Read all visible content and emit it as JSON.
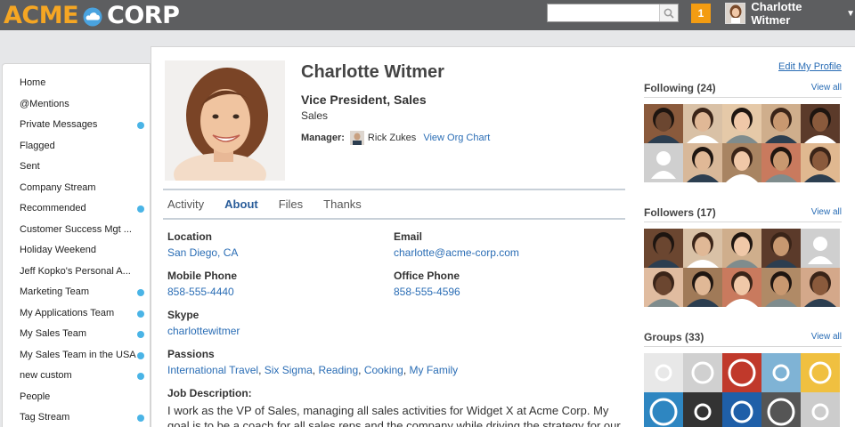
{
  "brand": {
    "acme": "ACME",
    "corp": "CORP",
    "logo_icon": "cloud-icon",
    "accent": "#f5a623"
  },
  "header": {
    "search_placeholder": "",
    "search_icon": "magnifier-icon",
    "notification_count": "1",
    "user_name": "Charlotte Witmer",
    "caret": "▼"
  },
  "sidebar": {
    "items": [
      {
        "label": "Home",
        "dot": false
      },
      {
        "label": "@Mentions",
        "dot": false
      },
      {
        "label": "Private Messages",
        "dot": true
      },
      {
        "label": "Flagged",
        "dot": false
      },
      {
        "label": "Sent",
        "dot": false
      },
      {
        "label": "Company Stream",
        "dot": false
      },
      {
        "label": "Recommended",
        "dot": true
      },
      {
        "label": "Customer Success Mgt ...",
        "dot": false
      },
      {
        "label": "Holiday Weekend",
        "dot": false
      },
      {
        "label": "Jeff Kopko's Personal A...",
        "dot": false
      },
      {
        "label": "Marketing Team",
        "dot": true
      },
      {
        "label": "My Applications Team",
        "dot": true
      },
      {
        "label": "My Sales Team",
        "dot": true
      },
      {
        "label": "My Sales Team in the USA",
        "dot": true
      },
      {
        "label": "new custom",
        "dot": true
      },
      {
        "label": "People",
        "dot": false
      },
      {
        "label": "Tag Stream",
        "dot": true
      }
    ]
  },
  "profile": {
    "name": "Charlotte Witmer",
    "title": "Vice President, Sales",
    "department": "Sales",
    "manager_label": "Manager:",
    "manager_name": "Rick Zukes",
    "org_chart_link": "View Org Chart",
    "edit_link": "Edit My Profile"
  },
  "tabs": [
    {
      "label": "Activity",
      "active": false
    },
    {
      "label": "About",
      "active": true
    },
    {
      "label": "Files",
      "active": false
    },
    {
      "label": "Thanks",
      "active": false
    }
  ],
  "about": {
    "location_label": "Location",
    "location": "San Diego, CA",
    "email_label": "Email",
    "email": "charlotte@acme-corp.com",
    "mobile_label": "Mobile Phone",
    "mobile": "858-555-4440",
    "office_label": "Office Phone",
    "office": "858-555-4596",
    "skype_label": "Skype",
    "skype": "charlottewitmer",
    "passions_label": "Passions",
    "passions": [
      "International Travel",
      "Six Sigma",
      "Reading",
      "Cooking",
      "My Family"
    ],
    "passions_sep": ", ",
    "job_label": "Job Description:",
    "job_text": "I work as the VP of Sales, managing all sales activities for Widget X at Acme Corp. My goal is to be a coach for all sales reps and the company while driving the strategy for our"
  },
  "following": {
    "title": "Following (24)",
    "view_all": "View all"
  },
  "followers": {
    "title": "Followers (17)",
    "view_all": "View all"
  },
  "groups": {
    "title": "Groups (33)",
    "view_all": "View all"
  },
  "following_tiles": [
    "#8a5a3c",
    "#d9c1a6",
    "#e5c9a8",
    "#cfae8c",
    "#5b3a2a",
    "#cfcfcf",
    "#d8b899",
    "#a88462",
    "#c97a5e",
    "#e0b890"
  ],
  "followers_tiles": [
    "#6b4630",
    "#d9c1a6",
    "#cfae8c",
    "#5b3a2a",
    "#cfcfcf",
    "#e0bca0",
    "#a07a58",
    "#c97a5e",
    "#b08a66",
    "#d4a88a"
  ],
  "groups_tiles": [
    "#e8e8e8",
    "#d0d0d0",
    "#c0392b",
    "#7fb3d5",
    "#f0c040",
    "#2e86c1",
    "#333333",
    "#1f5fa8",
    "#555555",
    "#cccccc"
  ]
}
